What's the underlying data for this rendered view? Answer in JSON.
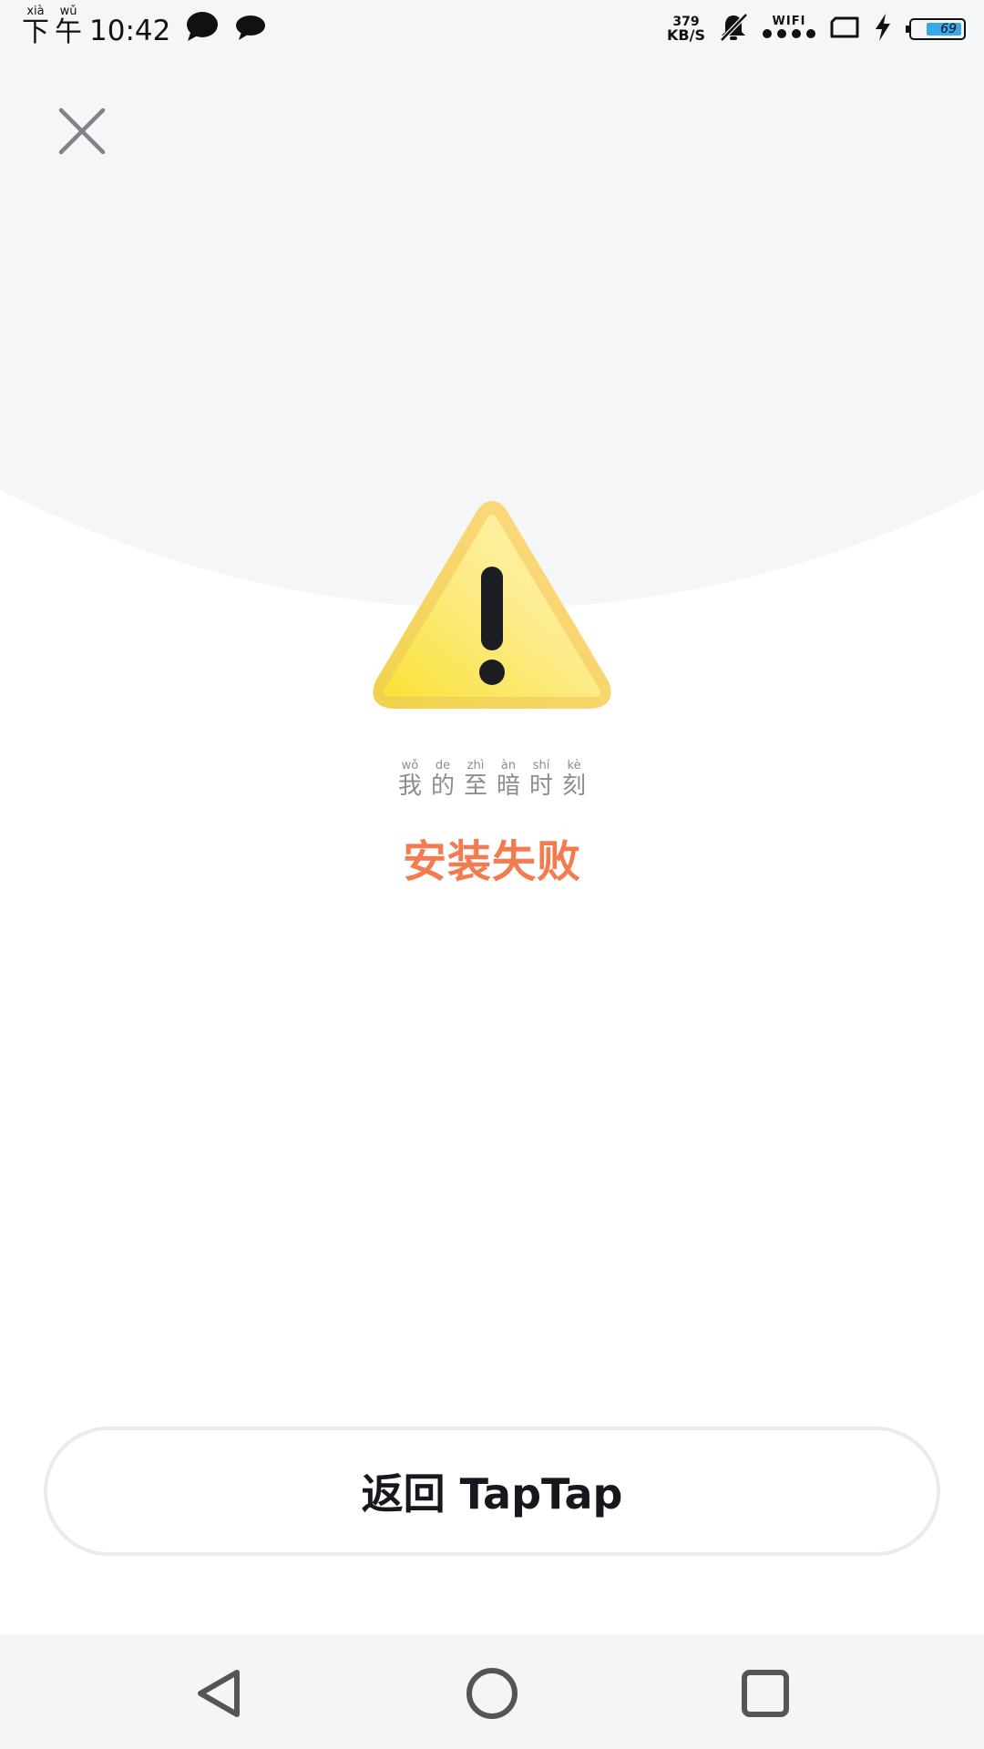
{
  "status_bar": {
    "time_prefix": [
      {
        "pinyin": "xià",
        "char": "下"
      },
      {
        "pinyin": "wǔ",
        "char": "午"
      }
    ],
    "time": "10:42",
    "net_speed_value": "379",
    "net_speed_unit": "KB/S",
    "wifi_label": "WIFI",
    "battery_level": "69",
    "icons": [
      "chat-bubble-icon",
      "chat-bubble-icon",
      "muted-bell-icon",
      "signal-dots-icon",
      "screen-rotate-icon",
      "charging-bolt-icon",
      "battery-icon"
    ]
  },
  "header": {
    "close_icon": "close-icon"
  },
  "result": {
    "icon": "warning-triangle-icon",
    "accent_color": "#f47b4f",
    "subtitle": [
      {
        "pinyin": "wǒ",
        "char": "我"
      },
      {
        "pinyin": "de",
        "char": "的"
      },
      {
        "pinyin": "zhì",
        "char": "至"
      },
      {
        "pinyin": "àn",
        "char": "暗"
      },
      {
        "pinyin": "shí",
        "char": "时"
      },
      {
        "pinyin": "kè",
        "char": "刻"
      }
    ],
    "title": "安装失败"
  },
  "actions": {
    "back_label": "返回 TapTap"
  },
  "nav_bar": {
    "icons": [
      "back-triangle-icon",
      "home-circle-icon",
      "recents-square-icon"
    ]
  }
}
